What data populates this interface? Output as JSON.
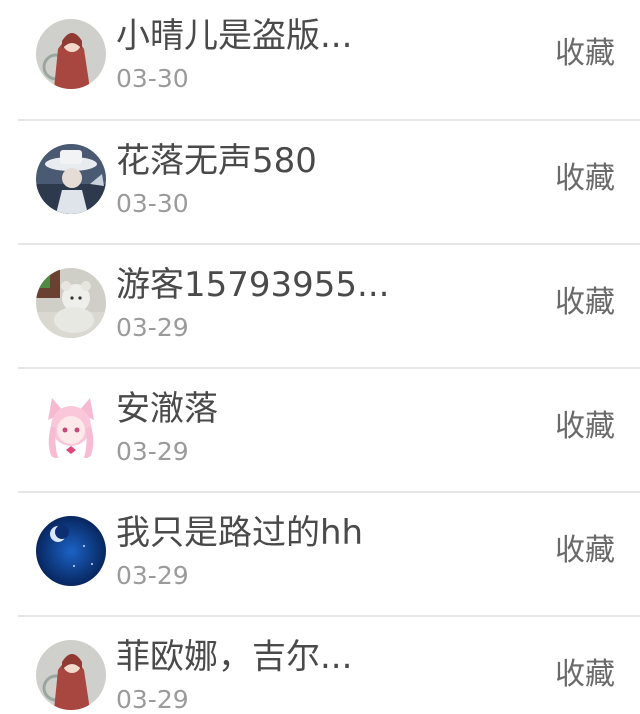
{
  "items": [
    {
      "name": "小晴儿是盗版...",
      "date": "03-30",
      "action": "收藏",
      "avatar": "redhood-girl-avatar-icon"
    },
    {
      "name": "花落无声580",
      "date": "03-30",
      "action": "收藏",
      "avatar": "hat-gentleman-avatar-icon"
    },
    {
      "name": "游客15793955...",
      "date": "03-29",
      "action": "收藏",
      "avatar": "teddy-bear-avatar-icon"
    },
    {
      "name": "安澈落",
      "date": "03-29",
      "action": "收藏",
      "avatar": "pink-catgirl-avatar-icon"
    },
    {
      "name": "我只是路过的hh",
      "date": "03-29",
      "action": "收藏",
      "avatar": "night-sky-avatar-icon"
    },
    {
      "name": "菲欧娜，吉尔...",
      "date": "03-29",
      "action": "收藏",
      "avatar": "redhood-girl-avatar-icon"
    }
  ]
}
